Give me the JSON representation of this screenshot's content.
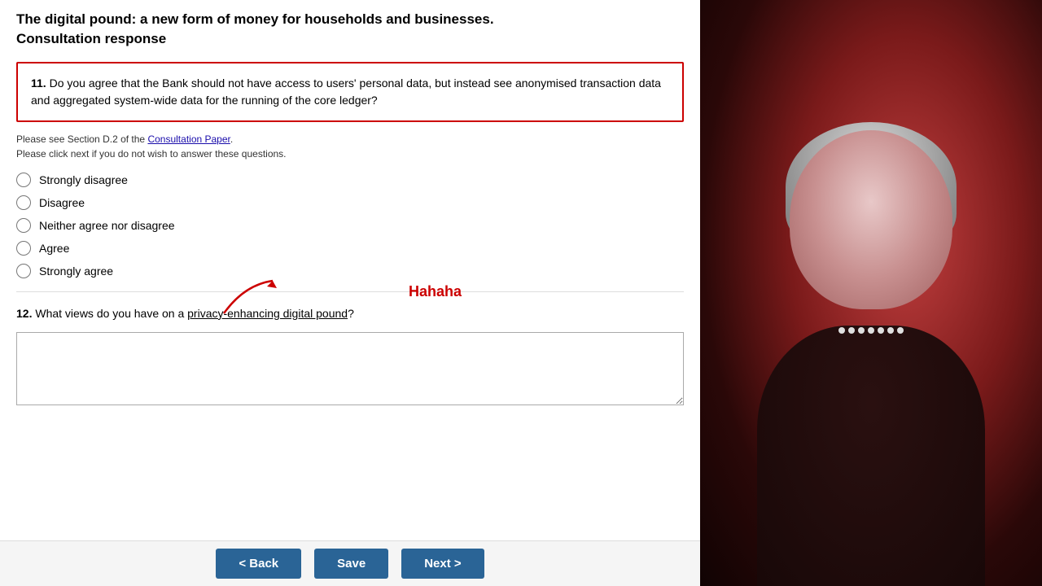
{
  "page": {
    "title_line1": "The digital pound: a new form of money for households and businesses.",
    "title_line2": "Consultation response"
  },
  "question11": {
    "number": "11.",
    "text": "Do you agree that the Bank should not have access to users' personal data, but instead see anonymised transaction data and aggregated system-wide data for the running of the core ledger?",
    "help_text_prefix": "Please see Section D.2 of the",
    "help_link_text": "Consultation Paper",
    "help_text_suffix": ".",
    "help_text_line2": "Please click next if you do not wish to answer these questions.",
    "options": [
      {
        "id": "strongly-disagree",
        "label": "Strongly disagree"
      },
      {
        "id": "disagree",
        "label": "Disagree"
      },
      {
        "id": "neither",
        "label": "Neither agree nor disagree"
      },
      {
        "id": "agree",
        "label": "Agree"
      },
      {
        "id": "strongly-agree",
        "label": "Strongly agree"
      }
    ]
  },
  "question12": {
    "number": "12.",
    "text_prefix": "What views do you have on a",
    "underlined_text": "privacy-enhancing digital pound",
    "text_suffix": "?",
    "annotation": "Hahaha",
    "textarea_placeholder": ""
  },
  "navigation": {
    "back_label": "< Back",
    "save_label": "Save",
    "next_label": "Next >"
  }
}
